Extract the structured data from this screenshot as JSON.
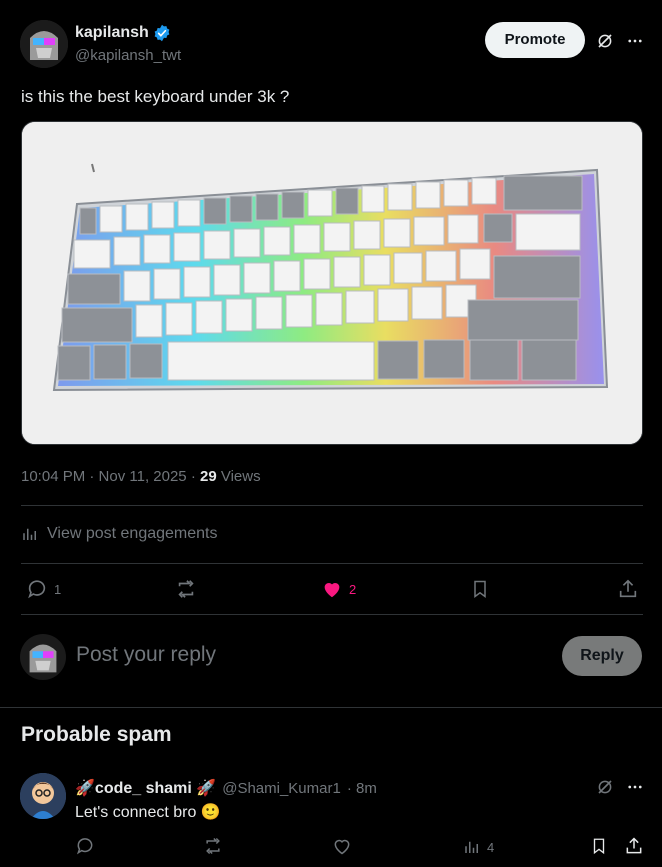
{
  "post": {
    "author_name": "kapilansh",
    "author_handle": "@kapilansh_twt",
    "promote_label": "Promote",
    "text": "is this the best keyboard under 3k ?",
    "time": "10:04 PM · Nov 11, 2025 · ",
    "views_count": "29",
    "views_label": "Views",
    "engagements_label": "View post engagements",
    "reply_count": "1",
    "like_count": "2"
  },
  "composer": {
    "placeholder": "Post your reply",
    "reply_label": "Reply"
  },
  "spam_section": {
    "title": "Probable spam",
    "reply": {
      "author_name": "🚀code_ shami 🚀",
      "author_handle": "@Shami_Kumar1",
      "time": "· 8m",
      "text": "Let's connect bro 🙂",
      "views_count": "4"
    }
  },
  "colors": {
    "accent_like": "#f91880",
    "verified": "#1d9bf0",
    "background": "#000000",
    "divider": "#2f3336"
  },
  "icons": [
    "verified-badge-icon",
    "grok-icon",
    "more-icon",
    "reply-icon",
    "repost-icon",
    "like-icon",
    "bookmark-icon",
    "share-icon",
    "analytics-icon"
  ]
}
